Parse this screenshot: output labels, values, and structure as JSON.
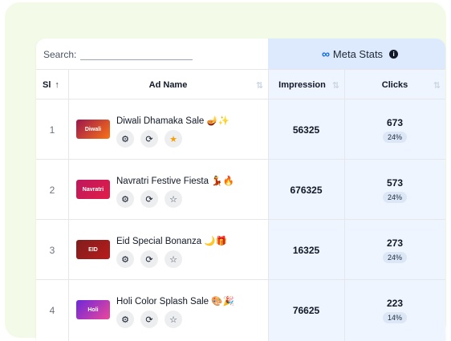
{
  "search": {
    "label": "Search:",
    "placeholder": ""
  },
  "meta_header": {
    "logo": "∞",
    "title": "Meta Stats",
    "info": "i"
  },
  "columns": {
    "sl": "Sl",
    "sl_sort": "↑",
    "ad_name": "Ad Name",
    "impression": "Impression",
    "clicks": "Clicks",
    "sort_icon": "⇅"
  },
  "rows": [
    {
      "sl": "1",
      "name": "Diwali Dhamaka Sale 🪔✨",
      "thumb_text": "Diwali",
      "thumb_color": "#7c2d12",
      "impression": "56325",
      "clicks": "673",
      "ctr": "24%",
      "starred": true
    },
    {
      "sl": "2",
      "name": "Navratri Festive Fiesta 💃🔥",
      "thumb_text": "Navratri",
      "thumb_color": "#be185d",
      "impression": "676325",
      "clicks": "573",
      "ctr": "24%",
      "starred": false
    },
    {
      "sl": "3",
      "name": "Eid Special Bonanza 🌙🎁",
      "thumb_text": "EID",
      "thumb_color": "#7f1d1d",
      "impression": "16325",
      "clicks": "273",
      "ctr": "24%",
      "starred": false
    },
    {
      "sl": "4",
      "name": "Holi Color Splash Sale 🎨🎉",
      "thumb_text": "Holi",
      "thumb_color": "#6d28d9",
      "impression": "76625",
      "clicks": "223",
      "ctr": "14%",
      "starred": false
    }
  ],
  "icons": {
    "settings": "⚙",
    "refresh": "⟳",
    "star_on": "★",
    "star_off": "☆"
  },
  "colors": {
    "bg_card": "#f3fbe8",
    "meta_header": "#dde9fd",
    "meta_body": "#eef5ff",
    "badge": "#dbe6f7",
    "star": "#f59e0b"
  }
}
